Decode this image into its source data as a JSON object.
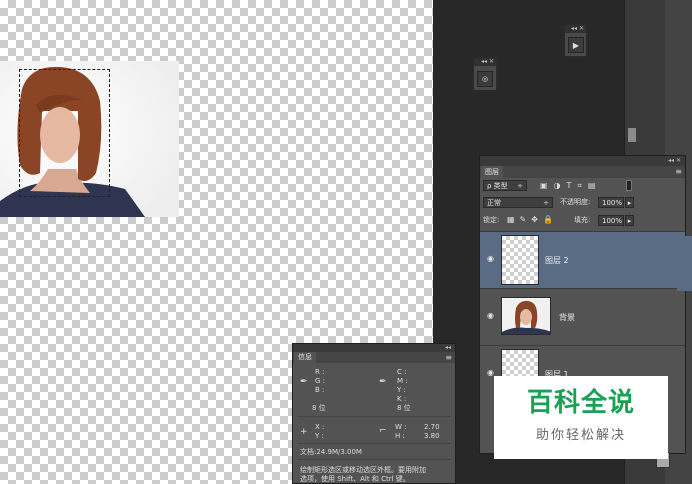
{
  "layers_panel": {
    "tab": "图层",
    "filter_kind": "ρ 类型",
    "blend_mode": "正常",
    "opacity_label": "不透明度:",
    "opacity_value": "100%",
    "lock_label": "锁定:",
    "fill_label": "填充:",
    "fill_value": "100%",
    "layers": [
      {
        "name": "图层 2",
        "active": true
      },
      {
        "name": "背景",
        "active": false
      },
      {
        "name": "图层 1",
        "active": false
      }
    ]
  },
  "info_panel": {
    "tab": "信息",
    "r": "R :",
    "g": "G :",
    "b": "B :",
    "bit_left": "8 位",
    "c": "C :",
    "m": "M :",
    "y": "Y :",
    "k": "K :",
    "bit_right": "8 位",
    "x": "X :",
    "yy": "Y :",
    "w": "W :",
    "h": "H :",
    "w_value": "2.70",
    "h_value": "3.80",
    "doc": "文档:24.9M/3.00M",
    "hint_line1": "绘制矩形选区或移动选区外框。要用附加",
    "hint_line2": "选项，使用 Shift、Alt 和 Ctrl 键。"
  },
  "watermark": {
    "title": "百科全说",
    "subtitle": "助你轻松解决"
  },
  "colors": {
    "active_layer": "#5a6b84",
    "watermark_green": "#1aa154"
  }
}
